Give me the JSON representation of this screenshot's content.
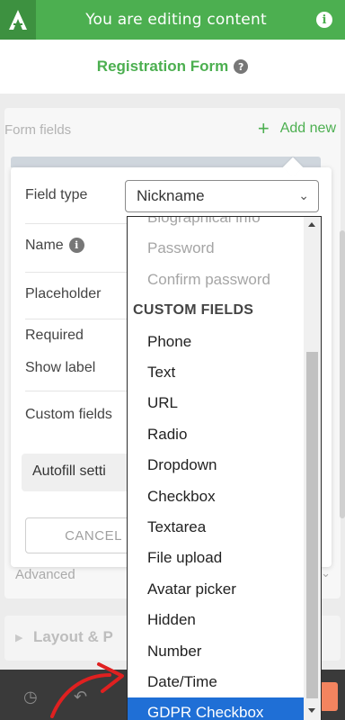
{
  "topbar": {
    "title": "You are editing content",
    "logo_icon": "brand-logo",
    "info_icon": "info-icon"
  },
  "header": {
    "title": "Registration Form",
    "help_icon": "help-icon"
  },
  "form_fields": {
    "label": "Form fields",
    "add_new": "Add new"
  },
  "editor": {
    "field_type_label": "Field type",
    "field_type_value": "Nickname",
    "name_label": "Name",
    "placeholder_label": "Placeholder",
    "required_label": "Required",
    "show_label_label": "Show label",
    "custom_fields_label": "Custom fields",
    "autofill_label": "Autofill setti",
    "cancel_label": "CANCEL"
  },
  "advanced": {
    "label": "Advanced"
  },
  "layout": {
    "label": "Layout & P"
  },
  "dropdown": {
    "options": [
      {
        "label": "Biographical info",
        "state": "disabled"
      },
      {
        "label": "Password",
        "state": "disabled"
      },
      {
        "label": "Confirm password",
        "state": "disabled"
      },
      {
        "label": "CUSTOM FIELDS",
        "state": "group"
      },
      {
        "label": "Phone",
        "state": "normal"
      },
      {
        "label": "Text",
        "state": "normal"
      },
      {
        "label": "URL",
        "state": "normal"
      },
      {
        "label": "Radio",
        "state": "normal"
      },
      {
        "label": "Dropdown",
        "state": "normal"
      },
      {
        "label": "Checkbox",
        "state": "normal"
      },
      {
        "label": "Textarea",
        "state": "normal"
      },
      {
        "label": "File upload",
        "state": "normal"
      },
      {
        "label": "Avatar picker",
        "state": "normal"
      },
      {
        "label": "Hidden",
        "state": "normal"
      },
      {
        "label": "Number",
        "state": "normal"
      },
      {
        "label": "Date/Time",
        "state": "normal"
      },
      {
        "label": "GDPR Checkbox",
        "state": "selected"
      }
    ]
  },
  "colors": {
    "brand_green": "#4caf50",
    "selection_blue": "#1f6fd6",
    "annotation_red": "#e02020"
  }
}
